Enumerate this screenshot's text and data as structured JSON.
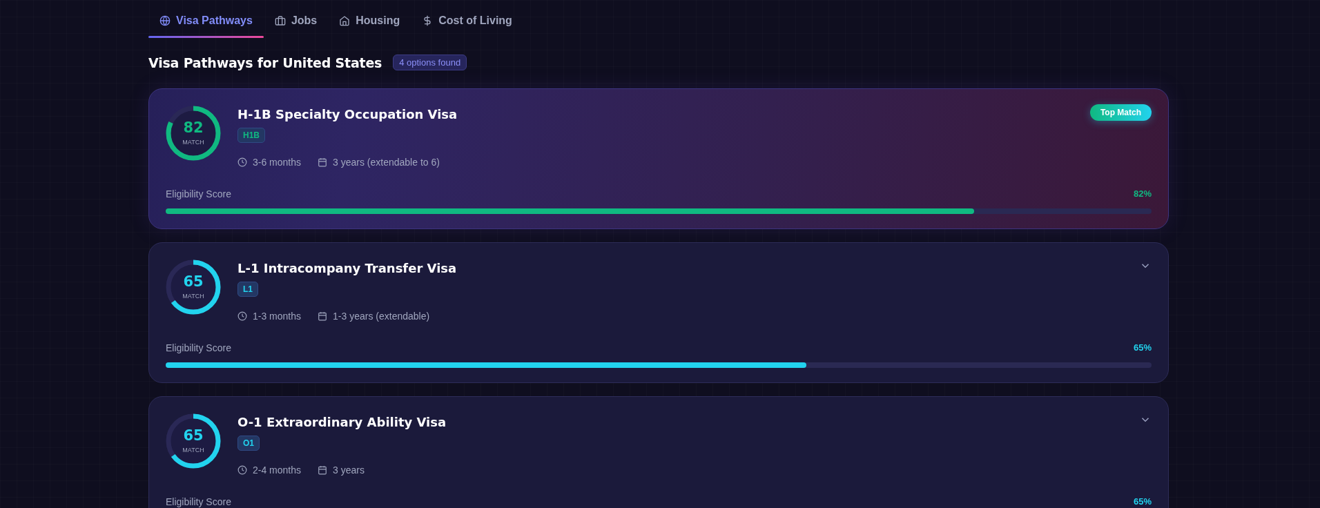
{
  "tabs": [
    {
      "label": "Visa Pathways",
      "selected": true
    },
    {
      "label": "Jobs",
      "selected": false
    },
    {
      "label": "Housing",
      "selected": false
    },
    {
      "label": "Cost of Living",
      "selected": false
    }
  ],
  "heading": {
    "title": "Visa Pathways for United States",
    "count": "4 options found"
  },
  "visas": [
    {
      "score": "82",
      "score_label": "MATCH",
      "title": "H-1B Specialty Occupation Visa",
      "code": "H1B",
      "processing": "3-6 months",
      "duration": "3 years (extendable to 6)",
      "eligibility_label": "Eligibility Score",
      "percent": "82%",
      "level": 0.82,
      "color": "#10b981",
      "top_match": true,
      "top_match_label": "Top Match"
    },
    {
      "score": "65",
      "score_label": "MATCH",
      "title": "L-1 Intracompany Transfer Visa",
      "code": "L1",
      "processing": "1-3 months",
      "duration": "1-3 years (extendable)",
      "eligibility_label": "Eligibility Score",
      "percent": "65%",
      "level": 0.65,
      "color": "#22d3ee",
      "top_match": false
    },
    {
      "score": "65",
      "score_label": "MATCH",
      "title": "O-1 Extraordinary Ability Visa",
      "code": "O1",
      "processing": "2-4 months",
      "duration": "3 years",
      "eligibility_label": "Eligibility Score",
      "percent": "65%",
      "level": 0.65,
      "color": "#22d3ee",
      "top_match": false
    }
  ]
}
